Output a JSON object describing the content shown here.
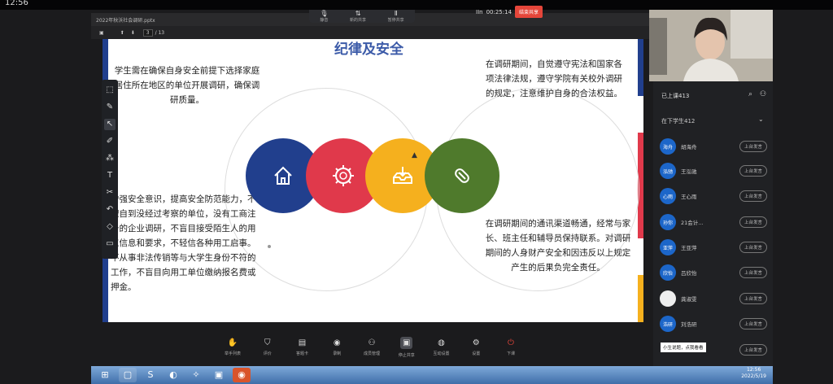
{
  "phone": {
    "time": "12:56"
  },
  "topbar": {
    "items": [
      {
        "icon": "mic-icon",
        "glyph": "🎙",
        "label": "静音"
      },
      {
        "icon": "share-icon",
        "glyph": "⇅",
        "label": "新的共享"
      },
      {
        "icon": "pause-icon",
        "glyph": "Ⅱ",
        "label": "暂停共享"
      }
    ],
    "rec_label": "IIn",
    "timer": "00:25:14",
    "end_label": "结束共享"
  },
  "window": {
    "filename": "2022年秋沃社会调研.pptx"
  },
  "pdfbar": {
    "page": "3",
    "total": "/ 13"
  },
  "slide": {
    "title": "纪律及安全",
    "top_left": "学生需在确保自身安全前提下选择家庭居住所在地区的单位开展调研，确保调研质量。",
    "bottom_left": "增强安全意识，提高安全防范能力，不擅自到没经过考察的单位，没有工商注册的企业调研，不盲目接受陌生人的用工信息和要求，不轻信各种用工启事。不从事非法传销等与大学生身份不符的工作，不盲目向用工单位缴纳报名费或押金。",
    "top_right": "在调研期间，自觉遵守宪法和国家各项法律法规，遵守学院有关校外调研的规定，注意维护自身的合法权益。",
    "bottom_right": "在调研期间的通讯渠道畅通，经常与家长、班主任和辅导员保持联系。对调研期间的人身财产安全和因违反以上规定产生的后果负完全责任。",
    "circles": [
      {
        "icon": "home-icon",
        "color": "#213f8d"
      },
      {
        "icon": "gear-icon",
        "color": "#e0394b"
      },
      {
        "icon": "tray-icon",
        "color": "#f5b01e"
      },
      {
        "icon": "pill-icon",
        "color": "#4f7a2c"
      }
    ]
  },
  "tools": [
    "⬚",
    "✎",
    "↖",
    "✐",
    "⁂",
    "T",
    "✂",
    "↶",
    "◇",
    "▭"
  ],
  "participants": {
    "online": "已上课413",
    "section": "在下学生412",
    "students": [
      {
        "avatar": "海舟",
        "name": "胡海舟",
        "btn": "上台发言"
      },
      {
        "avatar": "泓驰",
        "name": "王泓驰",
        "btn": "上台发言"
      },
      {
        "avatar": "心雨",
        "name": "王心雨",
        "btn": "上台发言"
      },
      {
        "avatar": "孙你",
        "name": "21会计...",
        "btn": "上台发言"
      },
      {
        "avatar": "亚萍",
        "name": "王亚萍",
        "btn": "上台发言"
      },
      {
        "avatar": "欣怡",
        "name": "吕欣怡",
        "btn": "上台发言"
      },
      {
        "avatar": "",
        "name": "龚淑雯",
        "btn": "上台发言"
      },
      {
        "avatar": "浩研",
        "name": "刘浩研",
        "btn": "上台发言"
      },
      {
        "avatar": "",
        "name": "",
        "btn": "上台发言"
      }
    ],
    "tooltip": "小生说题，点我看看"
  },
  "bottombar": [
    {
      "icon": "hand-icon",
      "glyph": "✋",
      "label": "举手列表"
    },
    {
      "icon": "shield-icon",
      "glyph": "⛉",
      "label": "评价"
    },
    {
      "icon": "card-icon",
      "glyph": "▤",
      "label": "答题卡"
    },
    {
      "icon": "record-icon",
      "glyph": "◉",
      "label": "录制"
    },
    {
      "icon": "members-icon",
      "glyph": "⚇",
      "label": "成员管理"
    },
    {
      "icon": "screen-share-icon",
      "glyph": "▣",
      "label": "停止共享"
    },
    {
      "icon": "interact-icon",
      "glyph": "◍",
      "label": "互动设置"
    },
    {
      "icon": "settings-icon",
      "glyph": "⚙",
      "label": "设置"
    },
    {
      "icon": "exit-icon",
      "glyph": "⏻",
      "label": "下课"
    }
  ],
  "taskbar": {
    "apps": [
      "⊞",
      "▢",
      "S",
      "◐",
      "✧",
      "▣",
      "◉"
    ],
    "time": "12:56",
    "date": "2022/5/19"
  }
}
